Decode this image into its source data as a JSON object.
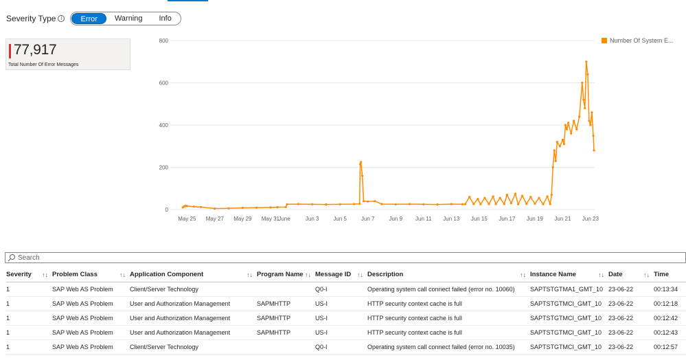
{
  "severity_filter": {
    "label": "Severity Type",
    "options": [
      "Error",
      "Warning",
      "Info"
    ],
    "selected": "Error"
  },
  "kpi": {
    "value": "77,917",
    "label": "Total Number Of Error Messages",
    "accent_color": "#d13438"
  },
  "legend": {
    "label": "Number Of System E..."
  },
  "chart_data": {
    "type": "line",
    "series_color": "#ff8c00",
    "ylim": [
      0,
      800
    ],
    "y_ticks": [
      "0",
      "200",
      "400",
      "600",
      "800"
    ],
    "x_ticks": [
      "May 25",
      "May 27",
      "May 29",
      "May 31",
      "June",
      "Jun 3",
      "Jun 5",
      "Jun 7",
      "Jun 9",
      "Jun 11",
      "Jun 13",
      "Jun 15",
      "Jun 17",
      "Jun 19",
      "Jun 21",
      "Jun 23"
    ],
    "x_tick_days": [
      0,
      2,
      4,
      6,
      7,
      9,
      11,
      13,
      15,
      17,
      19,
      21,
      23,
      25,
      27,
      29
    ],
    "x_range_days": [
      -1.2,
      29.3
    ],
    "grid": true,
    "legend_position": "top-right",
    "series": [
      {
        "name": "Number Of System E...",
        "x": [
          -0.3,
          -0.2,
          -0.1,
          0.0,
          0.5,
          1.0,
          2.0,
          3.0,
          4.0,
          5.0,
          6.0,
          6.5,
          7.1,
          7.2,
          8.0,
          9.0,
          10.0,
          11.0,
          12.0,
          12.4,
          12.45,
          12.5,
          12.6,
          12.7,
          13.0,
          13.5,
          14.0,
          15.0,
          16.0,
          17.0,
          18.0,
          19.0,
          19.8,
          20.0,
          20.3,
          20.6,
          20.9,
          21.1,
          21.4,
          21.7,
          22.0,
          22.2,
          22.5,
          22.8,
          23.0,
          23.3,
          23.6,
          23.8,
          24.1,
          24.4,
          24.7,
          25.0,
          25.3,
          25.6,
          25.9,
          26.1,
          26.2,
          26.3,
          26.4,
          26.5,
          26.6,
          26.8,
          27.0,
          27.1,
          27.2,
          27.3,
          27.4,
          27.6,
          27.8,
          28.0,
          28.2,
          28.4,
          28.5,
          28.6,
          28.7,
          28.8,
          28.9,
          29.0,
          29.1,
          29.2,
          29.25
        ],
        "y": [
          10,
          15,
          18,
          17,
          14,
          12,
          5,
          6,
          8,
          9,
          10,
          11,
          12,
          25,
          26,
          25,
          24,
          25,
          26,
          27,
          215,
          225,
          160,
          40,
          38,
          40,
          26,
          25,
          26,
          25,
          24,
          26,
          25,
          26,
          60,
          26,
          50,
          25,
          55,
          26,
          62,
          26,
          55,
          26,
          70,
          30,
          75,
          25,
          65,
          27,
          60,
          28,
          55,
          25,
          62,
          26,
          70,
          200,
          280,
          230,
          320,
          300,
          330,
          310,
          400,
          380,
          410,
          360,
          420,
          380,
          440,
          600,
          520,
          480,
          700,
          640,
          420,
          400,
          460,
          350,
          280
        ]
      }
    ]
  },
  "search": {
    "placeholder": "Search"
  },
  "table": {
    "columns": [
      "Severity",
      "Problem Class",
      "Application Component",
      "Program Name",
      "Message ID",
      "Description",
      "Instance Name",
      "Date",
      "Time"
    ],
    "sort_icon": "↑↓",
    "rows": [
      [
        "1",
        "SAP Web AS Problem",
        "Client/Server Technology",
        "",
        "Q0-I",
        "Operating system call connect failed (error no. 10060)",
        "SAPTSTGTMA1_GMT_10",
        "23-06-22",
        "00:13:34"
      ],
      [
        "1",
        "SAP Web AS Problem",
        "User and Authorization Management",
        "SAPMHTTP",
        "US-I",
        "HTTP security context cache is full",
        "SAPTSTGTMCI_GMT_10",
        "23-06-22",
        "00:12:18"
      ],
      [
        "1",
        "SAP Web AS Problem",
        "User and Authorization Management",
        "SAPMHTTP",
        "US-I",
        "HTTP security context cache is full",
        "SAPTSTGTMCI_GMT_10",
        "23-06-22",
        "00:12:42"
      ],
      [
        "1",
        "SAP Web AS Problem",
        "User and Authorization Management",
        "SAPMHTTP",
        "US-I",
        "HTTP security context cache is full",
        "SAPTSTGTMCI_GMT_10",
        "23-06-22",
        "00:12:43"
      ],
      [
        "1",
        "SAP Web AS Problem",
        "Client/Server Technology",
        "",
        "Q0-I",
        "Operating system call connect failed (error no. 10035)",
        "SAPTSTGTMCI_GMT_10",
        "23-06-22",
        "00:12:57"
      ]
    ]
  }
}
